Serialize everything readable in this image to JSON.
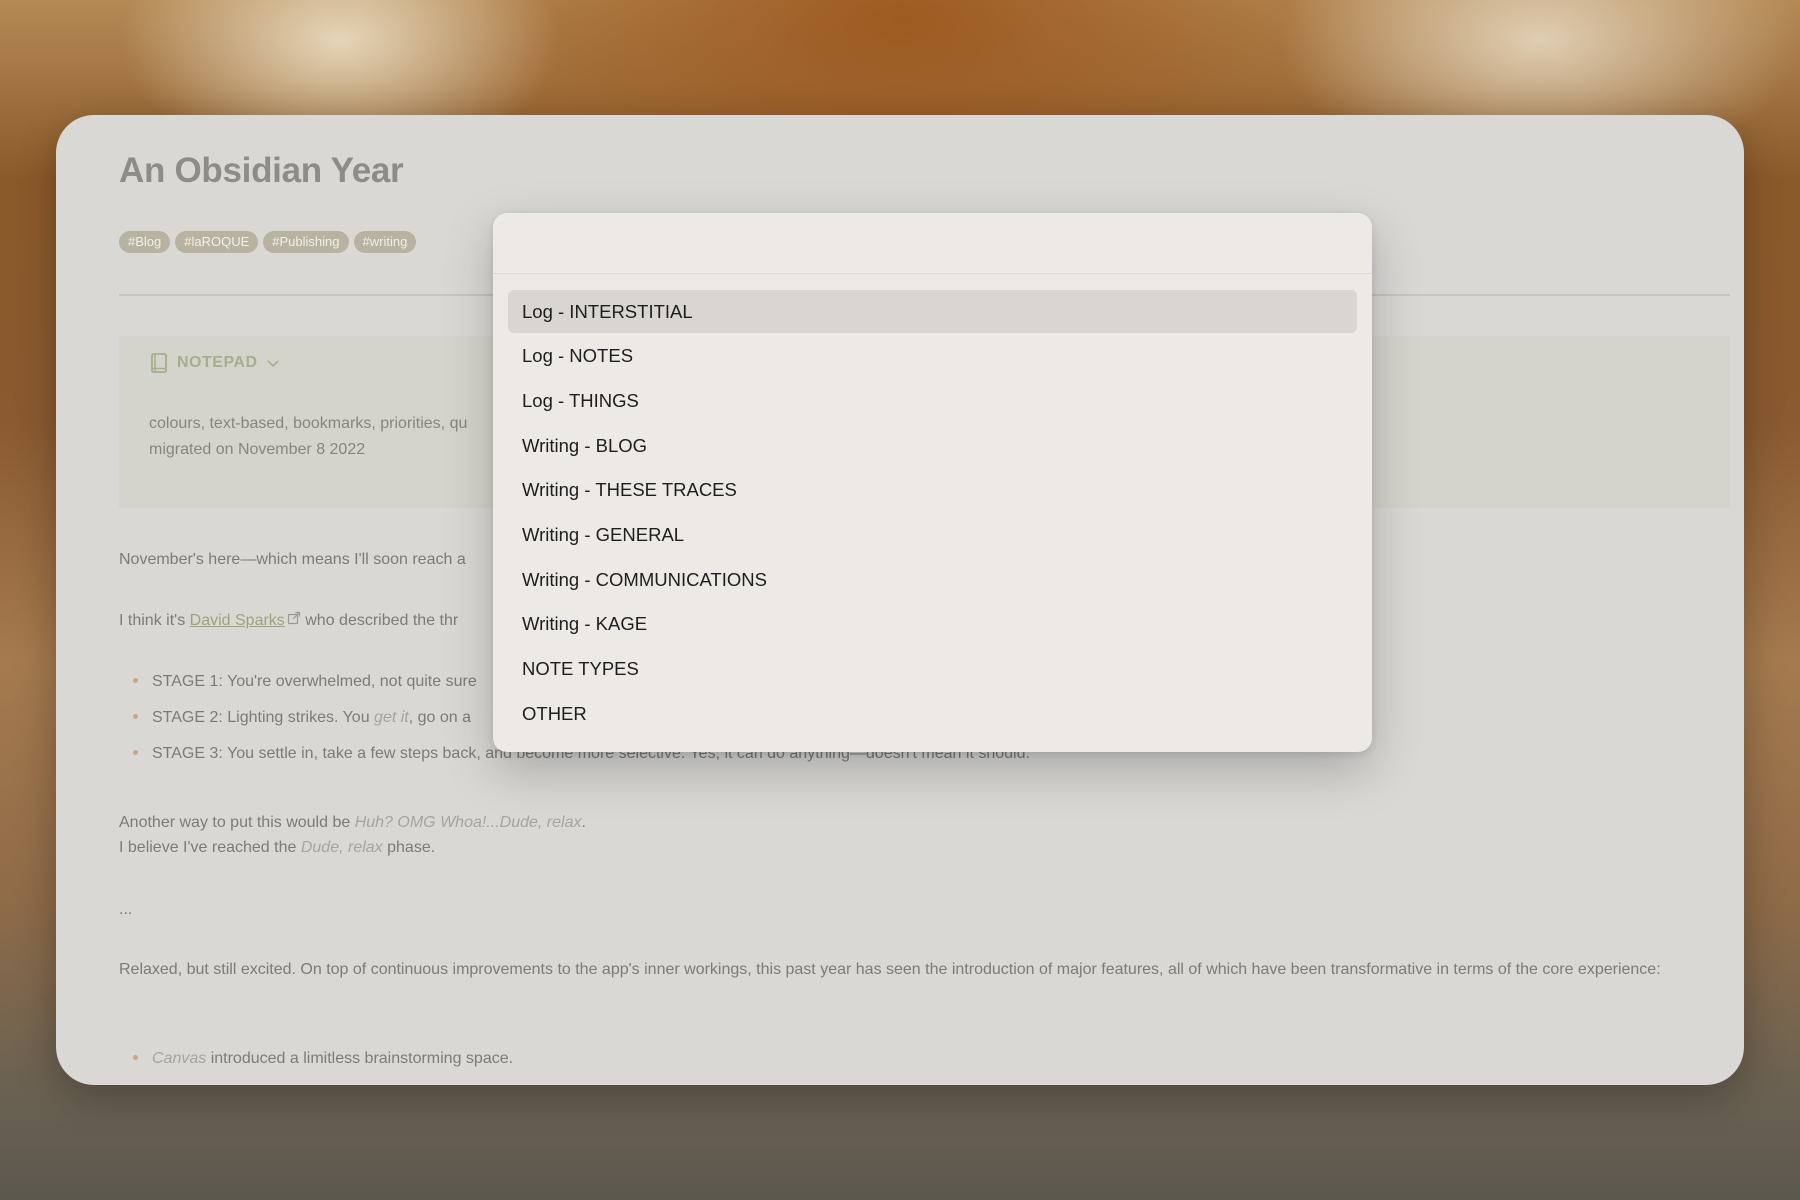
{
  "note": {
    "title": "An Obsidian Year",
    "tags": [
      "#Blog",
      "#laROQUE",
      "#Publishing",
      "#writing"
    ],
    "callout": {
      "title": "NOTEPAD",
      "line1": "colours, text-based, bookmarks, priorities, qu",
      "line2": "migrated on November 8 2022"
    },
    "p1": "November's here—which means I'll soon reach a",
    "p2": {
      "before": "I think it's ",
      "link": "David Sparks",
      "after": " who described the thr"
    },
    "stages": [
      {
        "text": "STAGE 1: You're overwhelmed, not quite sure"
      },
      {
        "before": "STAGE 2: Lighting strikes. You ",
        "italic": "get it",
        "after": ", go on a"
      },
      {
        "text": "STAGE 3: You settle in, take a few steps back, and become more selective. Yes, it can do anything—doesn't mean it should."
      }
    ],
    "p3": {
      "before": "Another way to put this would be ",
      "italic": "Huh? OMG Whoa!...Dude, relax",
      "after": "."
    },
    "p4": {
      "before": "I believe I've reached the ",
      "italic": "Dude, relax",
      "after": " phase."
    },
    "ellipsis": "...",
    "p5": "Relaxed, but still excited. On top of continuous improvements to the app's inner workings, this past year has seen the introduction of major features, all of which have been transformative in terms of the core experience:",
    "canvas_bullet": {
      "italic": "Canvas",
      "after": " introduced a limitless brainstorming space."
    }
  },
  "picker": {
    "search_placeholder": "",
    "selected_index": 0,
    "items": [
      "Log - INTERSTITIAL",
      "Log - NOTES",
      "Log - THINGS",
      "Writing - BLOG",
      "Writing - THESE TRACES",
      "Writing - GENERAL",
      "Writing - COMMUNICATIONS",
      "Writing - KAGE",
      "NOTE TYPES",
      "OTHER"
    ]
  },
  "icons": {
    "callout_icon": "book-icon",
    "callout_toggle": "chevron-down-icon",
    "link_icon": "external-link-icon"
  },
  "colors": {
    "accent_link": "#9ea479",
    "bullet": "#c8a982",
    "tag_bg": "#b8b3a1"
  }
}
